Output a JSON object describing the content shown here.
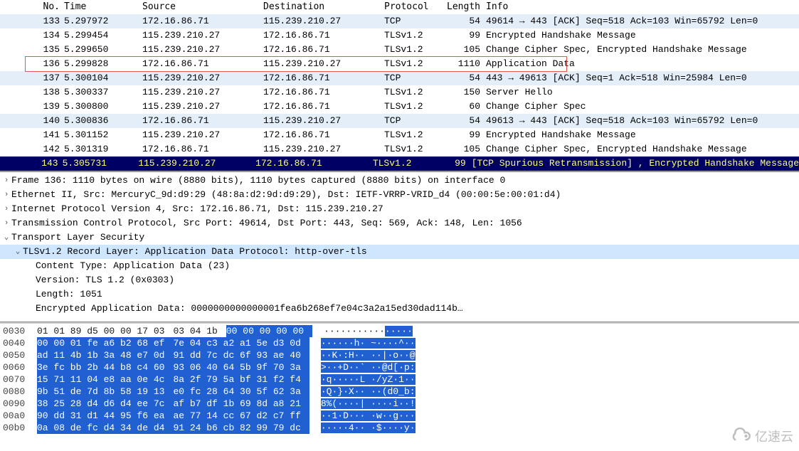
{
  "columns": {
    "no": "No.",
    "time": "Time",
    "source": "Source",
    "destination": "Destination",
    "protocol": "Protocol",
    "length": "Length",
    "info": "Info"
  },
  "packets": [
    {
      "no": "133",
      "time": "5.297972",
      "src": "172.16.86.71",
      "dst": "115.239.210.27",
      "proto": "TCP",
      "len": "54",
      "info": "49614 → 443 [ACK] Seq=518 Ack=103 Win=65792 Len=0",
      "cls": "tcp"
    },
    {
      "no": "134",
      "time": "5.299454",
      "src": "115.239.210.27",
      "dst": "172.16.86.71",
      "proto": "TLSv1.2",
      "len": "99",
      "info": "Encrypted Handshake Message",
      "cls": "tls"
    },
    {
      "no": "135",
      "time": "5.299650",
      "src": "115.239.210.27",
      "dst": "172.16.86.71",
      "proto": "TLSv1.2",
      "len": "105",
      "info": "Change Cipher Spec, Encrypted Handshake Message",
      "cls": "tls"
    },
    {
      "no": "136",
      "time": "5.299828",
      "src": "172.16.86.71",
      "dst": "115.239.210.27",
      "proto": "TLSv1.2",
      "len": "1110",
      "info": "Application Data",
      "cls": "tls",
      "highlighted": true
    },
    {
      "no": "137",
      "time": "5.300104",
      "src": "115.239.210.27",
      "dst": "172.16.86.71",
      "proto": "TCP",
      "len": "54",
      "info": "443 → 49613 [ACK] Seq=1 Ack=518 Win=25984 Len=0",
      "cls": "tcp"
    },
    {
      "no": "138",
      "time": "5.300337",
      "src": "115.239.210.27",
      "dst": "172.16.86.71",
      "proto": "TLSv1.2",
      "len": "150",
      "info": "Server Hello",
      "cls": "tls"
    },
    {
      "no": "139",
      "time": "5.300800",
      "src": "115.239.210.27",
      "dst": "172.16.86.71",
      "proto": "TLSv1.2",
      "len": "60",
      "info": "Change Cipher Spec",
      "cls": "tls"
    },
    {
      "no": "140",
      "time": "5.300836",
      "src": "172.16.86.71",
      "dst": "115.239.210.27",
      "proto": "TCP",
      "len": "54",
      "info": "49613 → 443 [ACK] Seq=518 Ack=103 Win=65792 Len=0",
      "cls": "tcp"
    },
    {
      "no": "141",
      "time": "5.301152",
      "src": "115.239.210.27",
      "dst": "172.16.86.71",
      "proto": "TLSv1.2",
      "len": "99",
      "info": "Encrypted Handshake Message",
      "cls": "tls"
    },
    {
      "no": "142",
      "time": "5.301319",
      "src": "172.16.86.71",
      "dst": "115.239.210.27",
      "proto": "TLSv1.2",
      "len": "105",
      "info": "Change Cipher Spec, Encrypted Handshake Message",
      "cls": "tls"
    },
    {
      "no": "143",
      "time": "5.305731",
      "src": "115.239.210.27",
      "dst": "172.16.86.71",
      "proto": "TLSv1.2",
      "len": "99",
      "info": "[TCP Spurious Retransmission] , Encrypted Handshake Message",
      "cls": "selected"
    }
  ],
  "details": {
    "frame": "Frame 136: 1110 bytes on wire (8880 bits), 1110 bytes captured (8880 bits) on interface 0",
    "eth": "Ethernet II, Src: MercuryC_9d:d9:29 (48:8a:d2:9d:d9:29), Dst: IETF-VRRP-VRID_d4 (00:00:5e:00:01:d4)",
    "ip": "Internet Protocol Version 4, Src: 172.16.86.71, Dst: 115.239.210.27",
    "tcp": "Transmission Control Protocol, Src Port: 49614, Dst Port: 443, Seq: 569, Ack: 148, Len: 1056",
    "tls": "Transport Layer Security",
    "record": "TLSv1.2 Record Layer: Application Data Protocol: http-over-tls",
    "ctype": "Content Type: Application Data (23)",
    "version": "Version: TLS 1.2 (0x0303)",
    "length": "Length: 1051",
    "encdata": "Encrypted Application Data: 0000000000000001fea6b268ef7e04c3a2a15ed30dad114b…"
  },
  "hex": [
    {
      "off": "0030",
      "p1": "01 01 89 d5 00 00 17 03",
      "p2": "03 04 1b",
      "s1": "00 00 00 00 00",
      "a1": "···········",
      "a2": "·····"
    },
    {
      "off": "0040",
      "s0": "00 00 01 fe a6 b2 68 ef",
      "s1": "7e 04 c3 a2 a1 5e d3 0d",
      "a0": "······h· ~····^··"
    },
    {
      "off": "0050",
      "s0": "ad 11 4b 1b 3a 48 e7 0d",
      "s1": "91 dd 7c dc 6f 93 ae 40",
      "a0": "··K·:H·· ··|·o··@"
    },
    {
      "off": "0060",
      "s0": "3e fc bb 2b 44 b8 c4 60",
      "s1": "93 06 40 64 5b 9f 70 3a",
      "a0": ">··+D··` ··@d[·p:"
    },
    {
      "off": "0070",
      "s0": "15 71 11 04 e8 aa 0e 4c",
      "s1": "8a 2f 79 5a bf 31 f2 f4",
      "a0": "·q·····L ·/yZ·1··"
    },
    {
      "off": "0080",
      "s0": "9b 51 de 7d 8b 58 19 13",
      "s1": "e0 fc 28 64 30 5f 62 3a",
      "a0": "·Q·}·X·· ··(d0_b:"
    },
    {
      "off": "0090",
      "s0": "38 25 28 d4 d6 d4 ee 7c",
      "s1": "af b7 df 1b 69 8d a8 21",
      "a0": "8%(····| ····i··!"
    },
    {
      "off": "00a0",
      "s0": "90 dd 31 d1 44 95 f6 ea",
      "s1": "ae 77 14 cc 67 d2 c7 ff",
      "a0": "··1·D··· ·w··g···"
    },
    {
      "off": "00b0",
      "s0": "0a 08 de fc d4 34 de d4",
      "s1": "91 24 b6 cb 82 99 79 dc",
      "a0": "·····4·· ·$····y·"
    }
  ],
  "chart_data": {
    "type": "table",
    "title": "Wireshark packet capture",
    "columns": [
      "No.",
      "Time",
      "Source",
      "Destination",
      "Protocol",
      "Length",
      "Info"
    ],
    "rows": [
      [
        133,
        "5.297972",
        "172.16.86.71",
        "115.239.210.27",
        "TCP",
        54,
        "49614 → 443 [ACK] Seq=518 Ack=103 Win=65792 Len=0"
      ],
      [
        134,
        "5.299454",
        "115.239.210.27",
        "172.16.86.71",
        "TLSv1.2",
        99,
        "Encrypted Handshake Message"
      ],
      [
        135,
        "5.299650",
        "115.239.210.27",
        "172.16.86.71",
        "TLSv1.2",
        105,
        "Change Cipher Spec, Encrypted Handshake Message"
      ],
      [
        136,
        "5.299828",
        "172.16.86.71",
        "115.239.210.27",
        "TLSv1.2",
        1110,
        "Application Data"
      ],
      [
        137,
        "5.300104",
        "115.239.210.27",
        "172.16.86.71",
        "TCP",
        54,
        "443 → 49613 [ACK] Seq=1 Ack=518 Win=25984 Len=0"
      ],
      [
        138,
        "5.300337",
        "115.239.210.27",
        "172.16.86.71",
        "TLSv1.2",
        150,
        "Server Hello"
      ],
      [
        139,
        "5.300800",
        "115.239.210.27",
        "172.16.86.71",
        "TLSv1.2",
        60,
        "Change Cipher Spec"
      ],
      [
        140,
        "5.300836",
        "172.16.86.71",
        "115.239.210.27",
        "TCP",
        54,
        "49613 → 443 [ACK] Seq=518 Ack=103 Win=65792 Len=0"
      ],
      [
        141,
        "5.301152",
        "115.239.210.27",
        "172.16.86.71",
        "TLSv1.2",
        99,
        "Encrypted Handshake Message"
      ],
      [
        142,
        "5.301319",
        "172.16.86.71",
        "115.239.210.27",
        "TLSv1.2",
        105,
        "Change Cipher Spec, Encrypted Handshake Message"
      ],
      [
        143,
        "5.305731",
        "115.239.210.27",
        "172.16.86.71",
        "TLSv1.2",
        99,
        "[TCP Spurious Retransmission] , Encrypted Handshake Message"
      ]
    ]
  },
  "watermark": "亿速云"
}
